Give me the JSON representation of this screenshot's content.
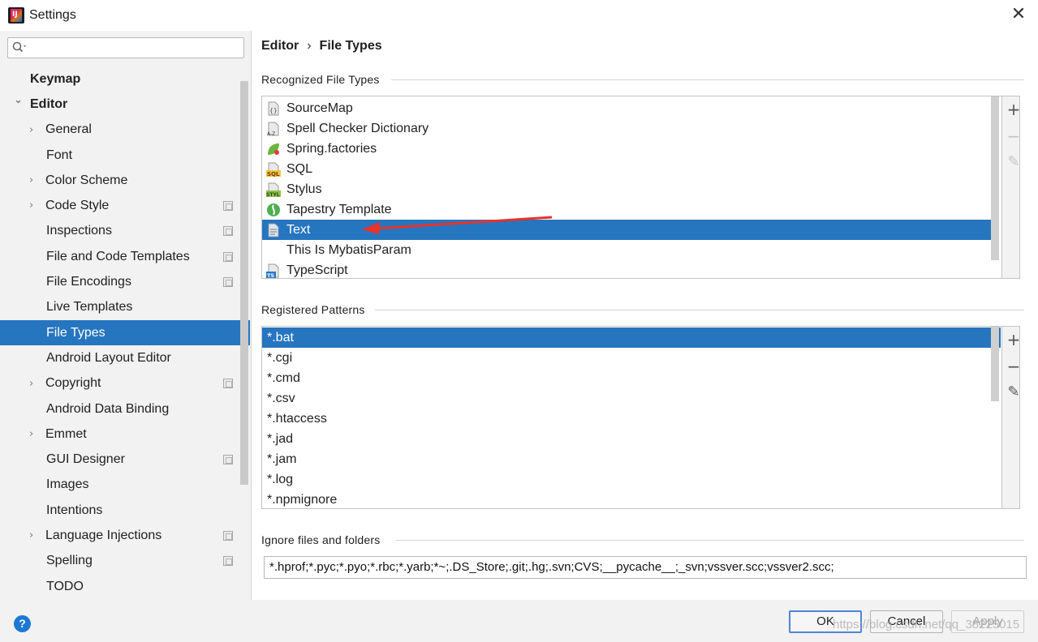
{
  "window": {
    "title": "Settings",
    "app_icon_text": "IJ"
  },
  "search": {
    "placeholder": ""
  },
  "sidebar": {
    "items": [
      {
        "label": "Keymap",
        "level": 0,
        "bold": true,
        "expand": "none",
        "project": false
      },
      {
        "label": "Editor",
        "level": 0,
        "bold": true,
        "expand": "open",
        "project": false
      },
      {
        "label": "General",
        "level": 1,
        "bold": false,
        "expand": "closed",
        "project": false
      },
      {
        "label": "Font",
        "level": 1,
        "bold": false,
        "expand": "none",
        "project": false
      },
      {
        "label": "Color Scheme",
        "level": 1,
        "bold": false,
        "expand": "closed",
        "project": false
      },
      {
        "label": "Code Style",
        "level": 1,
        "bold": false,
        "expand": "closed",
        "project": true
      },
      {
        "label": "Inspections",
        "level": 1,
        "bold": false,
        "expand": "none",
        "project": true
      },
      {
        "label": "File and Code Templates",
        "level": 1,
        "bold": false,
        "expand": "none",
        "project": true
      },
      {
        "label": "File Encodings",
        "level": 1,
        "bold": false,
        "expand": "none",
        "project": true
      },
      {
        "label": "Live Templates",
        "level": 1,
        "bold": false,
        "expand": "none",
        "project": false
      },
      {
        "label": "File Types",
        "level": 1,
        "bold": false,
        "expand": "none",
        "project": false,
        "selected": true
      },
      {
        "label": "Android Layout Editor",
        "level": 1,
        "bold": false,
        "expand": "none",
        "project": false
      },
      {
        "label": "Copyright",
        "level": 1,
        "bold": false,
        "expand": "closed",
        "project": true
      },
      {
        "label": "Android Data Binding",
        "level": 1,
        "bold": false,
        "expand": "none",
        "project": false
      },
      {
        "label": "Emmet",
        "level": 1,
        "bold": false,
        "expand": "closed",
        "project": false
      },
      {
        "label": "GUI Designer",
        "level": 1,
        "bold": false,
        "expand": "none",
        "project": true
      },
      {
        "label": "Images",
        "level": 1,
        "bold": false,
        "expand": "none",
        "project": false
      },
      {
        "label": "Intentions",
        "level": 1,
        "bold": false,
        "expand": "none",
        "project": false
      },
      {
        "label": "Language Injections",
        "level": 1,
        "bold": false,
        "expand": "closed",
        "project": true
      },
      {
        "label": "Spelling",
        "level": 1,
        "bold": false,
        "expand": "none",
        "project": true
      },
      {
        "label": "TODO",
        "level": 1,
        "bold": false,
        "expand": "none",
        "project": false
      }
    ]
  },
  "breadcrumb": {
    "parent": "Editor",
    "separator": "›",
    "current": "File Types"
  },
  "recognized": {
    "title": "Recognized File Types",
    "items": [
      {
        "label": "SourceMap",
        "icon": "sourcemap-file-icon"
      },
      {
        "label": "Spell Checker Dictionary",
        "icon": "dictionary-file-icon"
      },
      {
        "label": "Spring.factories",
        "icon": "spring-leaf-icon"
      },
      {
        "label": "SQL",
        "icon": "sql-file-icon"
      },
      {
        "label": "Stylus",
        "icon": "stylus-file-icon"
      },
      {
        "label": "Tapestry Template",
        "icon": "tapestry-icon"
      },
      {
        "label": "Text",
        "icon": "text-file-icon",
        "selected": true
      },
      {
        "label": "This Is MybatisParam",
        "icon": "none"
      },
      {
        "label": "TypeScript",
        "icon": "typescript-file-icon"
      }
    ]
  },
  "patterns": {
    "title": "Registered Patterns",
    "items": [
      {
        "label": "*.bat",
        "selected": true
      },
      {
        "label": "*.cgi"
      },
      {
        "label": "*.cmd"
      },
      {
        "label": "*.csv"
      },
      {
        "label": "*.htaccess"
      },
      {
        "label": "*.jad"
      },
      {
        "label": "*.jam"
      },
      {
        "label": "*.log"
      },
      {
        "label": "*.npmignore"
      }
    ]
  },
  "ignore": {
    "title": "Ignore files and folders",
    "value": "*.hprof;*.pyc;*.pyo;*.rbc;*.yarb;*~;.DS_Store;.git;.hg;.svn;CVS;__pycache__;_svn;vssver.scc;vssver2.scc;"
  },
  "toolbar": {
    "add": "+",
    "remove": "−",
    "edit": "✎"
  },
  "buttons": {
    "help": "?",
    "ok": "OK",
    "cancel": "Cancel",
    "apply": "Apply"
  },
  "watermark": "https://blog.csdn.net/qq_38225015",
  "colors": {
    "selection": "#2675bf",
    "sidebar_bg": "#f2f2f2",
    "arrow": "#e8322a",
    "help": "#1f77d4"
  }
}
